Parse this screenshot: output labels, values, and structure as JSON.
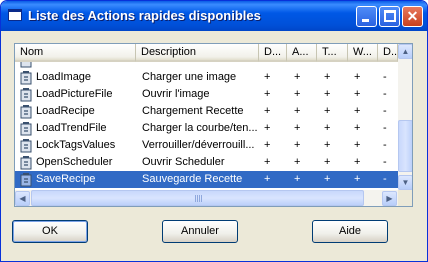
{
  "window": {
    "title": "Liste des Actions rapides disponibles"
  },
  "listview": {
    "columns": [
      "Nom",
      "Description",
      "D...",
      "A...",
      "T...",
      "W...",
      "D..."
    ],
    "rows": [
      {
        "name": "LoadImage",
        "description": "Charger une image",
        "flags": [
          "+",
          "+",
          "+",
          "+",
          "-"
        ],
        "selected": false
      },
      {
        "name": "LoadPictureFile",
        "description": "Ouvrir l'image",
        "flags": [
          "+",
          "+",
          "+",
          "+",
          "-"
        ],
        "selected": false
      },
      {
        "name": "LoadRecipe",
        "description": "Chargement Recette",
        "flags": [
          "+",
          "+",
          "+",
          "+",
          "-"
        ],
        "selected": false
      },
      {
        "name": "LoadTrendFile",
        "description": "Charger la courbe/ten...",
        "flags": [
          "+",
          "+",
          "+",
          "+",
          "-"
        ],
        "selected": false
      },
      {
        "name": "LockTagsValues",
        "description": "Verrouiller/déverrouill...",
        "flags": [
          "+",
          "+",
          "+",
          "+",
          "-"
        ],
        "selected": false
      },
      {
        "name": "OpenScheduler",
        "description": "Ouvrir Scheduler",
        "flags": [
          "+",
          "+",
          "+",
          "+",
          "-"
        ],
        "selected": false
      },
      {
        "name": "SaveRecipe",
        "description": "Sauvegarde Recette",
        "flags": [
          "+",
          "+",
          "+",
          "+",
          "-"
        ],
        "selected": true
      }
    ],
    "row_icon": "quick-action-icon",
    "vertical_scroll_fraction": 0.85
  },
  "buttons": {
    "ok": "OK",
    "cancel": "Annuler",
    "help": "Aide"
  },
  "colors": {
    "titlebar": "#0054E3",
    "selection": "#316AC5",
    "dialog_bg": "#ECE9D8",
    "close_button": "#D8532C"
  }
}
